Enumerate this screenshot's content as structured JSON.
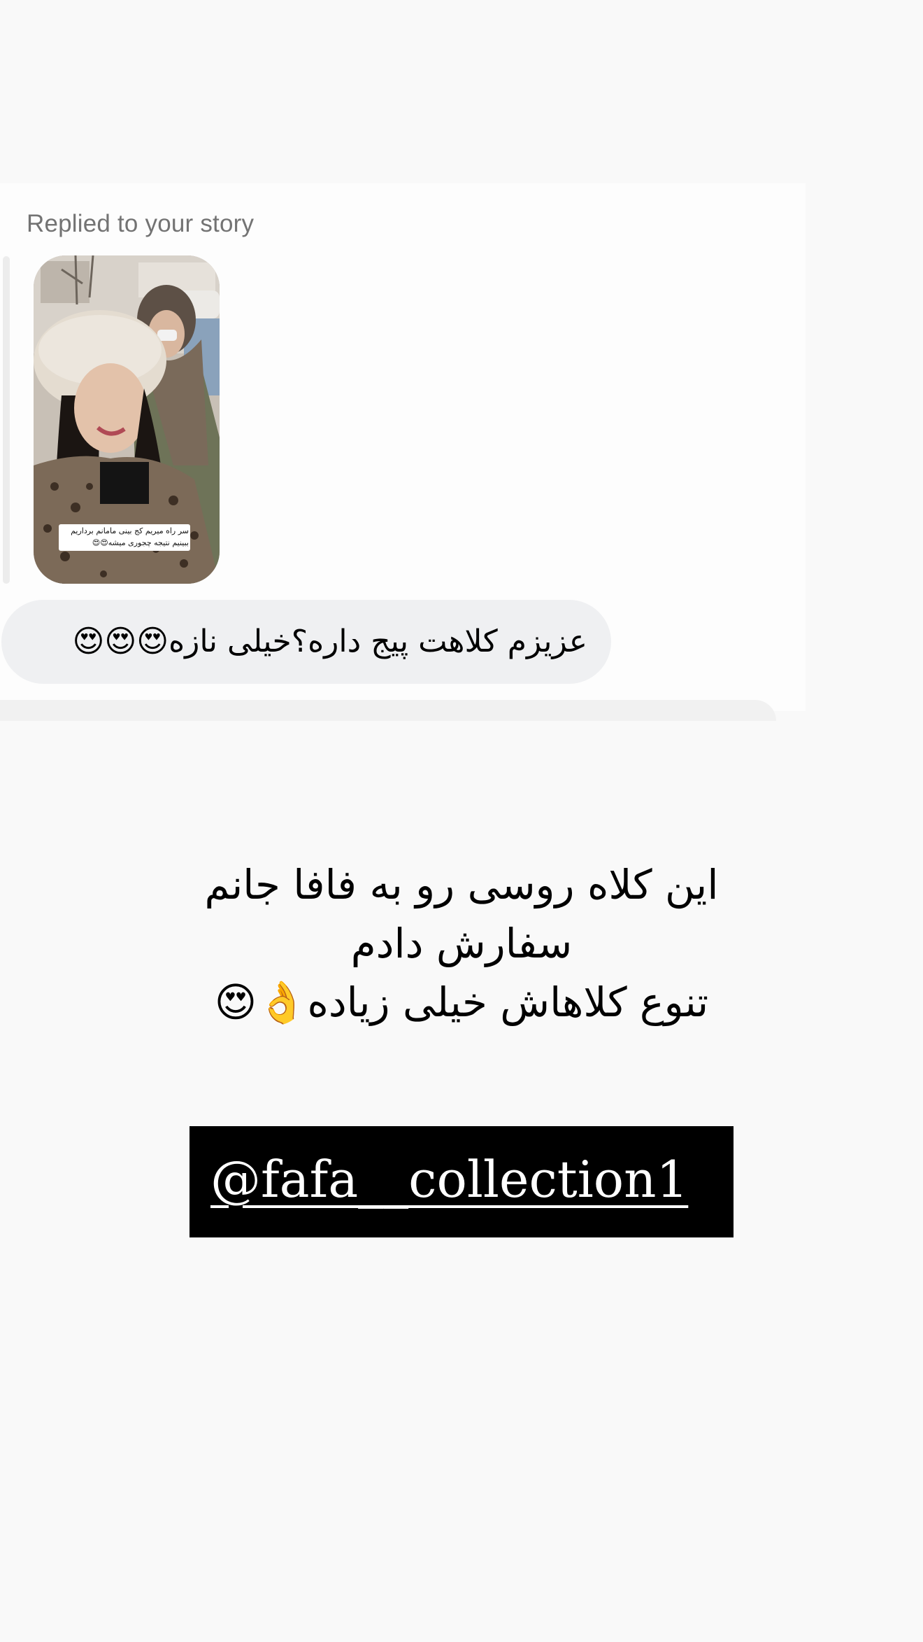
{
  "reply": {
    "label": "Replied to your story",
    "story_caption": "سر راه میریم کج بینی مامانم برداریم\nببینیم نتیجه چجوری میشه😍😍"
  },
  "message": {
    "text": "عزیزم کلاهت پیج داره؟خیلی نازه😍😍😍"
  },
  "story": {
    "main_text": "این کلاه روسی رو به فافا جانم\nسفارش دادم\nتنوع کلاهاش خیلی زیاده👌😍",
    "mention": "@fafa__collection1"
  },
  "colors": {
    "page_background": "#f9f9f9",
    "message_bubble": "#eff0f2",
    "label_gray": "#737373",
    "mention_background": "#000000",
    "mention_text": "#ffffff"
  }
}
